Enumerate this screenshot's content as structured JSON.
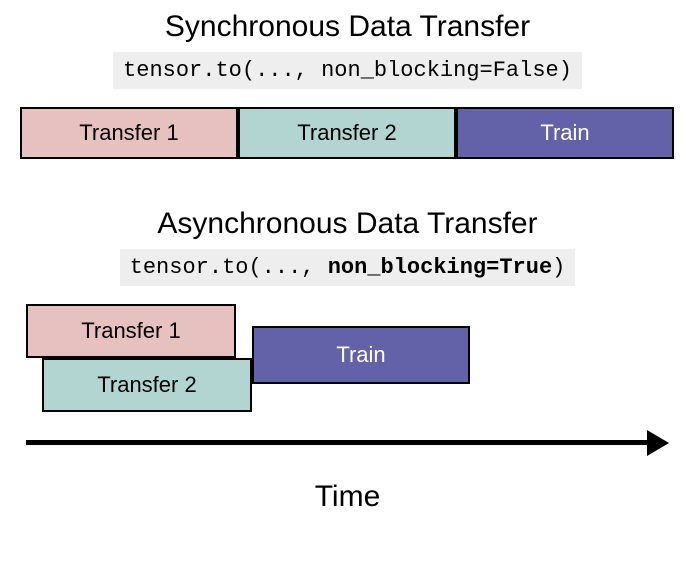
{
  "sync": {
    "title": "Synchronous Data Transfer",
    "code_prefix": "tensor.to(..., ",
    "code_arg": "non_blocking=False",
    "code_suffix": ")",
    "blocks": {
      "transfer1": "Transfer 1",
      "transfer2": "Transfer 2",
      "train": "Train"
    }
  },
  "async": {
    "title": "Asynchronous Data Transfer",
    "code_prefix": "tensor.to(..., ",
    "code_arg": "non_blocking=True",
    "code_suffix": ")",
    "blocks": {
      "transfer1": "Transfer 1",
      "transfer2": "Transfer 2",
      "train": "Train"
    }
  },
  "axis": {
    "label": "Time"
  },
  "colors": {
    "transfer1": "#e7c1bf",
    "transfer2": "#b3d5d1",
    "train": "#6362a9",
    "code_bg": "#eeeeee"
  }
}
